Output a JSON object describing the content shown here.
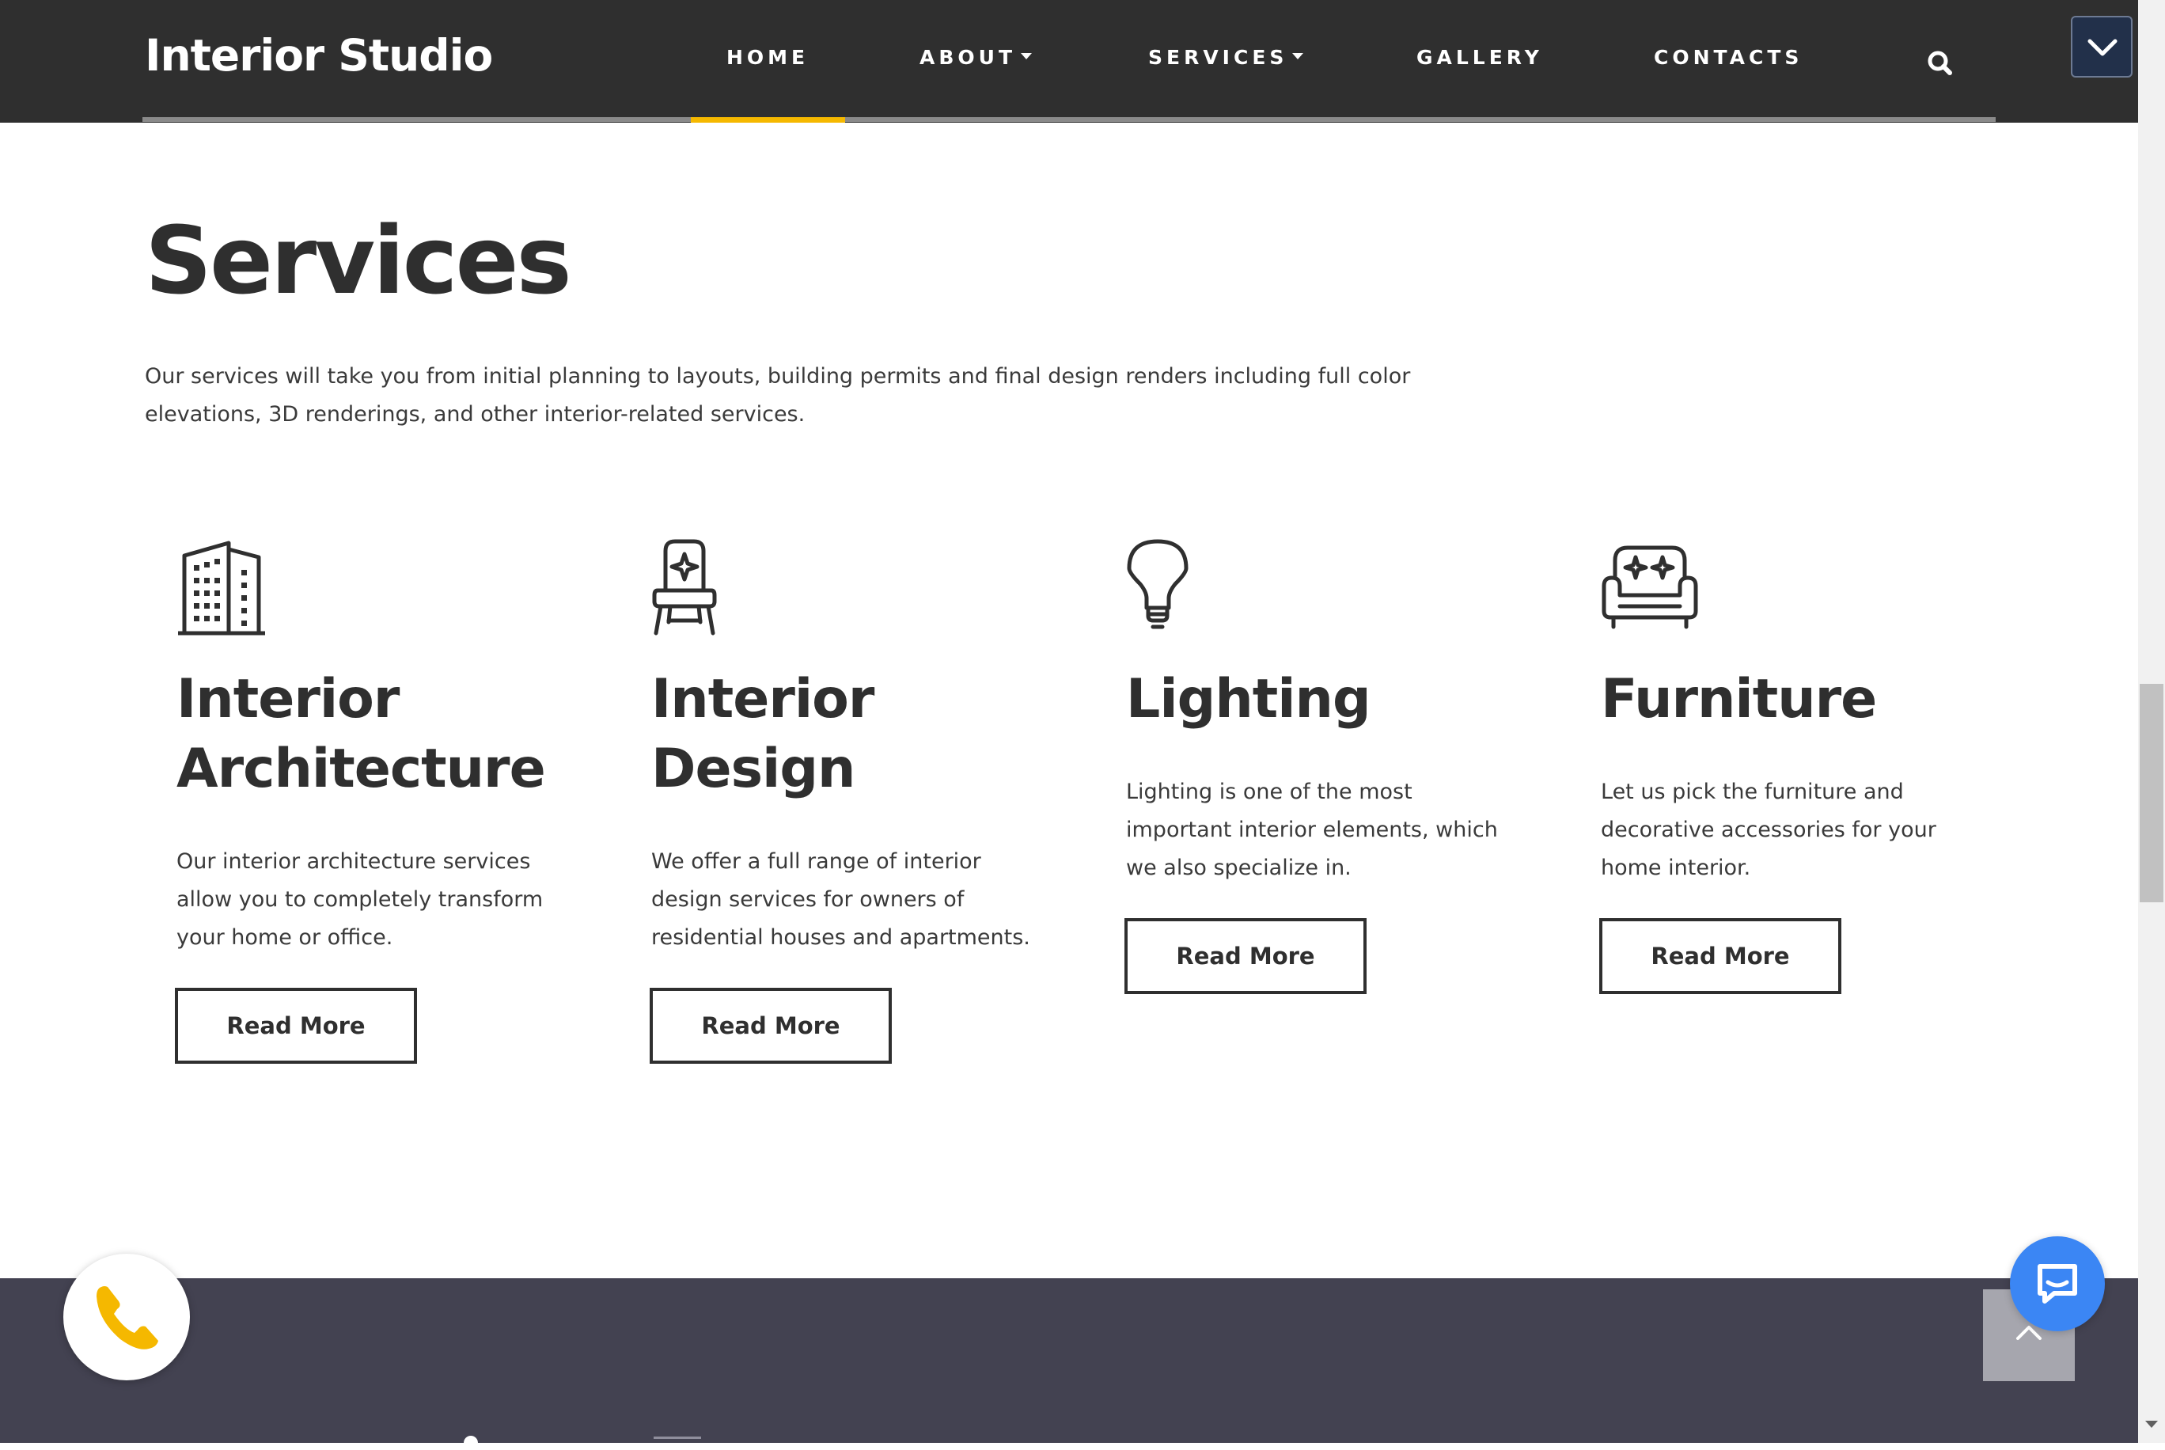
{
  "header": {
    "logo": "Interior Studio",
    "nav": [
      {
        "label": "HOME",
        "active": true
      },
      {
        "label": "ABOUT",
        "dropdown": true
      },
      {
        "label": "SERVICES",
        "dropdown": true
      },
      {
        "label": "GALLERY"
      },
      {
        "label": "CONTACTS"
      }
    ],
    "search_icon": "search-icon",
    "menu_toggle_icon": "chevron-down-icon"
  },
  "services": {
    "title": "Services",
    "intro": "Our services will take you from initial planning to layouts, building permits and final design renders including full color elevations, 3D renderings, and other interior-related services.",
    "cards": [
      {
        "icon": "building-icon",
        "title": "Interior Architecture",
        "text": "Our interior architecture services allow you to completely transform your home or office.",
        "button": "Read More"
      },
      {
        "icon": "chair-icon",
        "title": "Interior Design",
        "text": "We offer a full range of interior design services for owners of residential houses and apartments.",
        "button": "Read More"
      },
      {
        "icon": "light-bulb-icon",
        "title": "Lighting",
        "text": "Lighting is one of the most important interior elements, which we also specialize in.",
        "button": "Read More"
      },
      {
        "icon": "armchair-icon",
        "title": "Furniture",
        "text": "Let us pick the furniture and decorative accessories for your home interior.",
        "button": "Read More"
      }
    ]
  },
  "widgets": {
    "phone_icon": "phone-icon",
    "chat_icon": "chat-icon",
    "back_to_top_icon": "chevron-up-icon"
  },
  "colors": {
    "header_bg": "#2f2f2f",
    "accent": "#f5b800",
    "text_dark": "#2f2f2f",
    "footer_bg": "#434251",
    "chat_blue": "#3b86f4"
  }
}
